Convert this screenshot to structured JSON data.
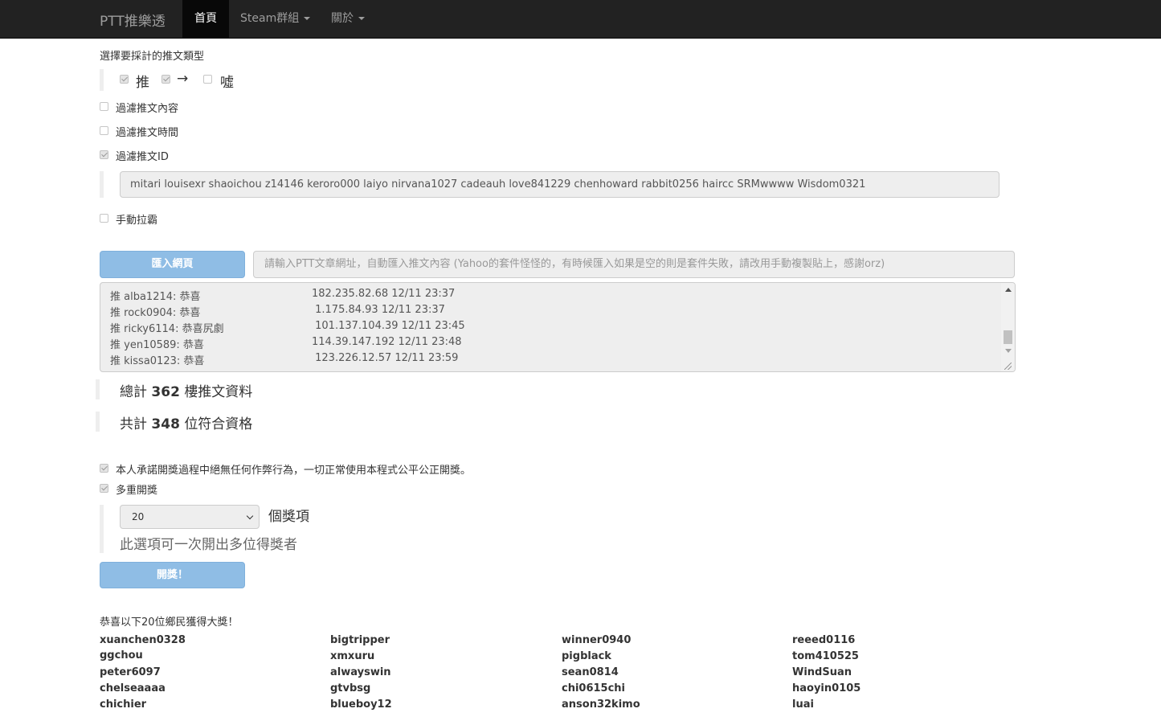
{
  "navbar": {
    "brand": "PTT推樂透",
    "items": [
      {
        "label": "首頁",
        "active": true,
        "dropdown": false
      },
      {
        "label": "Steam群組",
        "active": false,
        "dropdown": true
      },
      {
        "label": "關於",
        "active": false,
        "dropdown": true
      }
    ]
  },
  "push_types": {
    "title": "選擇要採計的推文類型",
    "options": [
      {
        "label": "推",
        "checked": true
      },
      {
        "label": "→",
        "checked": true
      },
      {
        "label": "噓",
        "checked": false
      }
    ]
  },
  "filters": {
    "content": {
      "label": "過濾推文內容",
      "checked": false
    },
    "time": {
      "label": "過濾推文時間",
      "checked": false
    },
    "id": {
      "label": "過濾推文ID",
      "checked": true
    },
    "id_value": "mitari louisexr shaoichou z14146 keroro000 laiyo nirvana1027 cadeauh love841229 chenhoward rabbit0256 haircc SRMwwww Wisdom0321",
    "manual": {
      "label": "手動拉霸",
      "checked": false
    }
  },
  "import": {
    "button_label": "匯入網頁",
    "url_placeholder": "請輸入PTT文章網址，自動匯入推文內容 (Yahoo的套件怪怪的，有時候匯入如果是空的則是套件失敗，請改用手動複製貼上，感謝orz)"
  },
  "push_log": [
    {
      "user": "推 alba1214: 恭喜",
      "meta": "182.235.82.68 12/11 23:37"
    },
    {
      "user": "推 rock0904: 恭喜",
      "meta": " 1.175.84.93 12/11 23:37"
    },
    {
      "user": "推 ricky6114: 恭喜尻劇",
      "meta": " 101.137.104.39 12/11 23:45"
    },
    {
      "user": "推 yen10589: 恭喜",
      "meta": "114.39.147.192 12/11 23:48"
    },
    {
      "user": "推 kissa0123: 恭喜",
      "meta": " 123.226.12.57 12/11 23:59"
    }
  ],
  "stats": {
    "total_prefix": "總計",
    "total_count": "362",
    "total_suffix": "樓推文資料",
    "qualified_prefix": "共計",
    "qualified_count": "348",
    "qualified_suffix": "位符合資格"
  },
  "draw": {
    "pledge": {
      "label": "本人承諾開獎過程中絕無任何作弊行為，一切正常使用本程式公平公正開獎。",
      "checked": true
    },
    "multi": {
      "label": "多重開獎",
      "checked": true
    },
    "prize_count": "20",
    "prize_unit": "個獎項",
    "multi_hint": "此選項可一次開出多位得獎者",
    "draw_button": "開獎！"
  },
  "results": {
    "title": "恭喜以下20位鄉民獲得大獎！",
    "winners": [
      "xuanchen0328",
      "bigtripper",
      "winner0940",
      "reeed0116",
      "ggchou",
      "xmxuru",
      "pigblack",
      "tom410525",
      "peter6097",
      "alwayswin",
      "sean0814",
      "WindSuan",
      "chelseaaaa",
      "gtvbsg",
      "chi0615chi",
      "haoyin0105",
      "chichier",
      "blueboy12",
      "anson32kimo",
      "luai"
    ]
  }
}
